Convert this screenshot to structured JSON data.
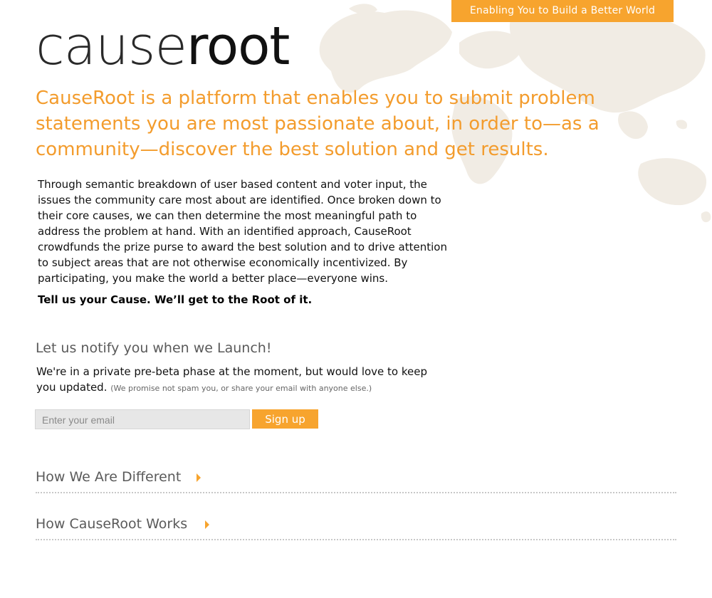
{
  "header": {
    "tagline": "Enabling You to Build a Better World"
  },
  "logo": {
    "part_thin": "cause",
    "part_bold": "root"
  },
  "intro": {
    "text": "CauseRoot is a platform that enables you to submit problem statements you are most passionate about, in order to—as a community—discover the best solution and get results."
  },
  "body": {
    "paragraph": "Through semantic breakdown of user based content and voter input, the issues the community care most about are identified. Once broken down to their core causes, we can then determine the most meaningful path to address the problem at hand. With an identified approach, CauseRoot crowdfunds the prize purse to award the best solution and to drive attention to subject areas that are not otherwise economically incentivized. By participating, you make the world a better place—everyone wins.",
    "slogan": "Tell us your Cause. We’ll get to the Root of it."
  },
  "notify": {
    "heading": "Let us notify you when we Launch!",
    "text": "We're in a private pre-beta phase at the moment, but would love to keep you updated.",
    "note": "(We promise not spam you, or share your email with anyone else.)",
    "email_placeholder": "Enter your email",
    "email_value": "",
    "signup_label": "Sign up"
  },
  "sections": [
    {
      "label": "How We Are Different",
      "icon": "chevron-right-icon"
    },
    {
      "label": "How CauseRoot Works",
      "icon": "chevron-right-icon"
    }
  ],
  "colors": {
    "accent": "#f7a42e",
    "intro_text": "#f39c2d",
    "heading_gray": "#5a5a5a",
    "map": "#f1ece4"
  }
}
